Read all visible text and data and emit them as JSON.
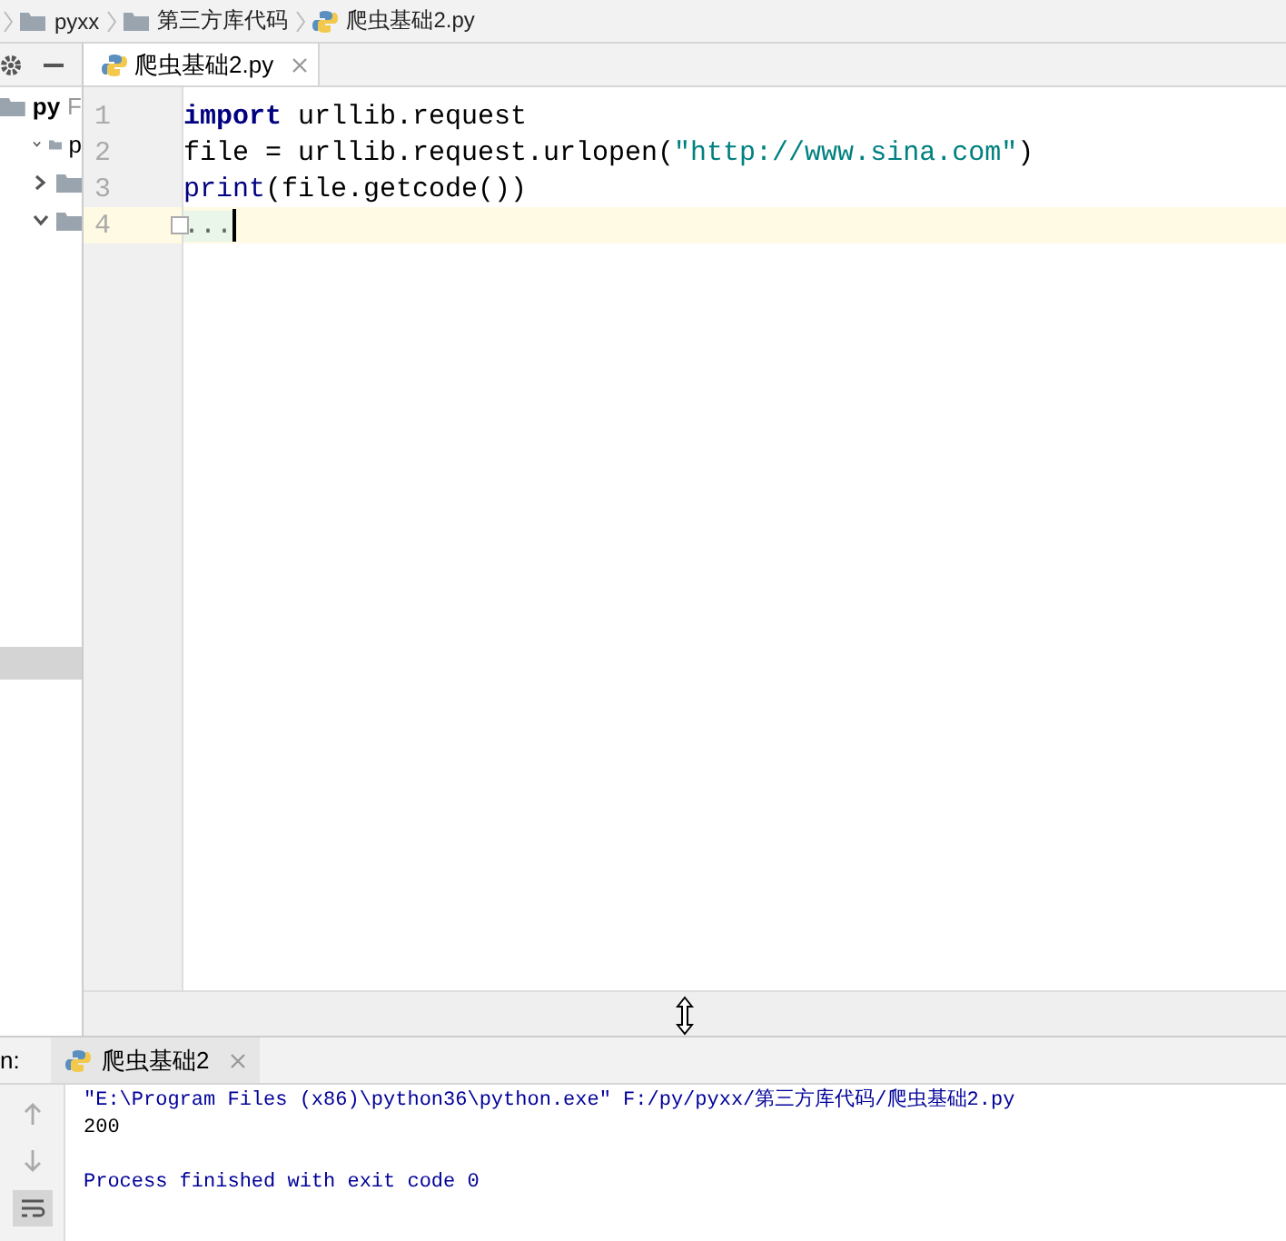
{
  "breadcrumbs": [
    {
      "label": "pyxx",
      "kind": "folder"
    },
    {
      "label": "第三方库代码",
      "kind": "folder"
    },
    {
      "label": "爬虫基础2.py",
      "kind": "python"
    }
  ],
  "project_tree": {
    "root": {
      "label": "py",
      "hint": "F"
    },
    "items": [
      {
        "label": "p",
        "expanded": true
      },
      {
        "expanded": false
      },
      {
        "expanded": true
      }
    ]
  },
  "editor": {
    "tab": {
      "label": "爬虫基础2.py",
      "selected": true
    },
    "lines": [
      {
        "number": "1",
        "current": false,
        "tokens": [
          {
            "text": "import",
            "kind": "keyword"
          },
          {
            "text": " urllib.request",
            "kind": "plain"
          }
        ]
      },
      {
        "number": "2",
        "current": false,
        "tokens": [
          {
            "text": "file = urllib.request.urlopen(",
            "kind": "plain"
          },
          {
            "text": "\"http://www.sina.com\"",
            "kind": "string"
          },
          {
            "text": ")",
            "kind": "plain"
          }
        ]
      },
      {
        "number": "3",
        "current": false,
        "tokens": [
          {
            "text": "print",
            "kind": "builtin"
          },
          {
            "text": "(file.getcode())",
            "kind": "plain"
          }
        ]
      },
      {
        "number": "4",
        "current": true,
        "folded": true,
        "tokens": [
          {
            "text": "...",
            "kind": "fold"
          }
        ]
      }
    ]
  },
  "run_panel": {
    "label": "n:",
    "tab": {
      "label": "爬虫基础2",
      "selected": true
    },
    "output": [
      {
        "text": "\"E:\\Program Files (x86)\\python36\\python.exe\" F:/py/pyxx/第三方库代码/爬虫基础2.py",
        "kind": "command"
      },
      {
        "text": "200",
        "kind": "output"
      },
      {
        "kind": "blank"
      },
      {
        "text": "Process finished with exit code 0",
        "kind": "status"
      }
    ]
  }
}
